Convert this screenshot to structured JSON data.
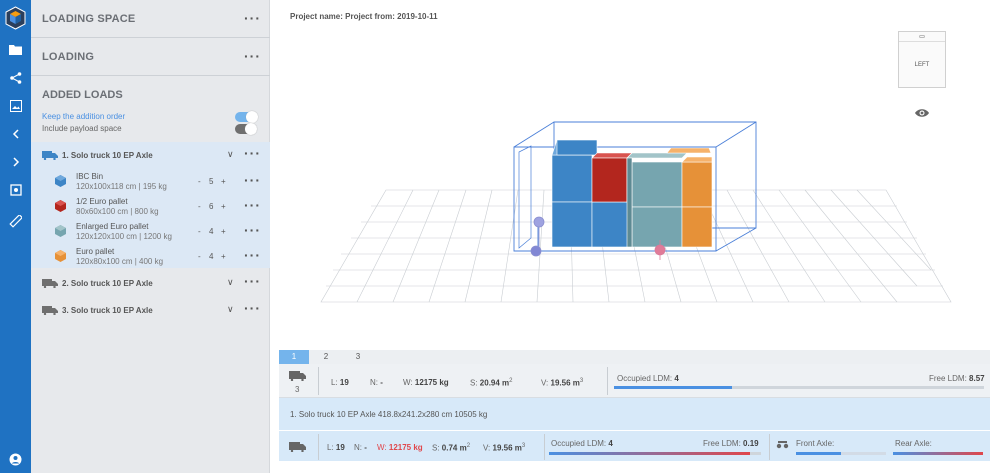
{
  "colors": {
    "rail": "#1f72c2",
    "accent": "#4a90e2",
    "red": "#e0474c",
    "ibc": "#3d85c6",
    "half": "#b3261e",
    "enlarged": "#76a5af",
    "euro": "#e69138"
  },
  "rail": {
    "icons": [
      "logo-icon",
      "folder-icon",
      "share-icon",
      "image-icon",
      "collapse-icon",
      "expand-icon",
      "settings-icon",
      "ruler-icon",
      "user-icon"
    ]
  },
  "sidebar": {
    "loading_space": "LOADING SPACE",
    "loading": "LOADING",
    "added_loads": "ADDED LOADS",
    "keep_order": "Keep the addition order",
    "include_payload": "Include payload space",
    "trucks": [
      {
        "label": "1. Solo truck 10 EP Axle",
        "expanded": true,
        "items": [
          {
            "name": "IBC Bin",
            "desc": "120x100x118 cm | 195 kg",
            "count": "5"
          },
          {
            "name": "1/2 Euro pallet",
            "desc": "80x60x100 cm | 800 kg",
            "count": "6"
          },
          {
            "name": "Enlarged Euro pallet",
            "desc": "120x120x100 cm | 1200 kg",
            "count": "4"
          },
          {
            "name": "Euro pallet",
            "desc": "120x80x100 cm | 400 kg",
            "count": "4"
          }
        ]
      },
      {
        "label": "2. Solo truck 10 EP Axle",
        "expanded": false
      },
      {
        "label": "3. Solo truck 10 EP Axle",
        "expanded": false
      }
    ],
    "minus": "-",
    "plus": "+"
  },
  "main": {
    "project_name": "Project name: Project from: 2019-10-11",
    "view_label": "LEFT",
    "tabs": [
      "1",
      "2",
      "3"
    ],
    "summary": {
      "truck_count": "3",
      "l_label": "L:",
      "l_value": "19",
      "n_label": "N:",
      "n_value": "-",
      "w_label": "W:",
      "w_value": "12175 kg",
      "s_label": "S:",
      "s_value": "20.94 m",
      "v_label": "V:",
      "v_value": "19.56 m",
      "occupied_label": "Occupied LDM:",
      "occupied_value": "4",
      "free_label": "Free LDM:",
      "free_value": "8.57",
      "occupied_fraction": 0.32
    },
    "truck_desc": "1. Solo truck 10 EP Axle 418.8x241.2x280 cm 10505 kg",
    "detail": {
      "l_label": "L:",
      "l_value": "19",
      "n_label": "N:",
      "n_value": "-",
      "w_label": "W:",
      "w_value": "12175 kg",
      "s_label": "S:",
      "s_value": "0.74 m",
      "v_label": "V:",
      "v_value": "19.56 m",
      "occupied_label": "Occupied LDM:",
      "occupied_value": "4",
      "free_label": "Free LDM:",
      "free_value": "0.19",
      "front_axle": "Front Axle:",
      "rear_axle": "Rear Axle:",
      "occupied_fraction": 0.95
    }
  }
}
